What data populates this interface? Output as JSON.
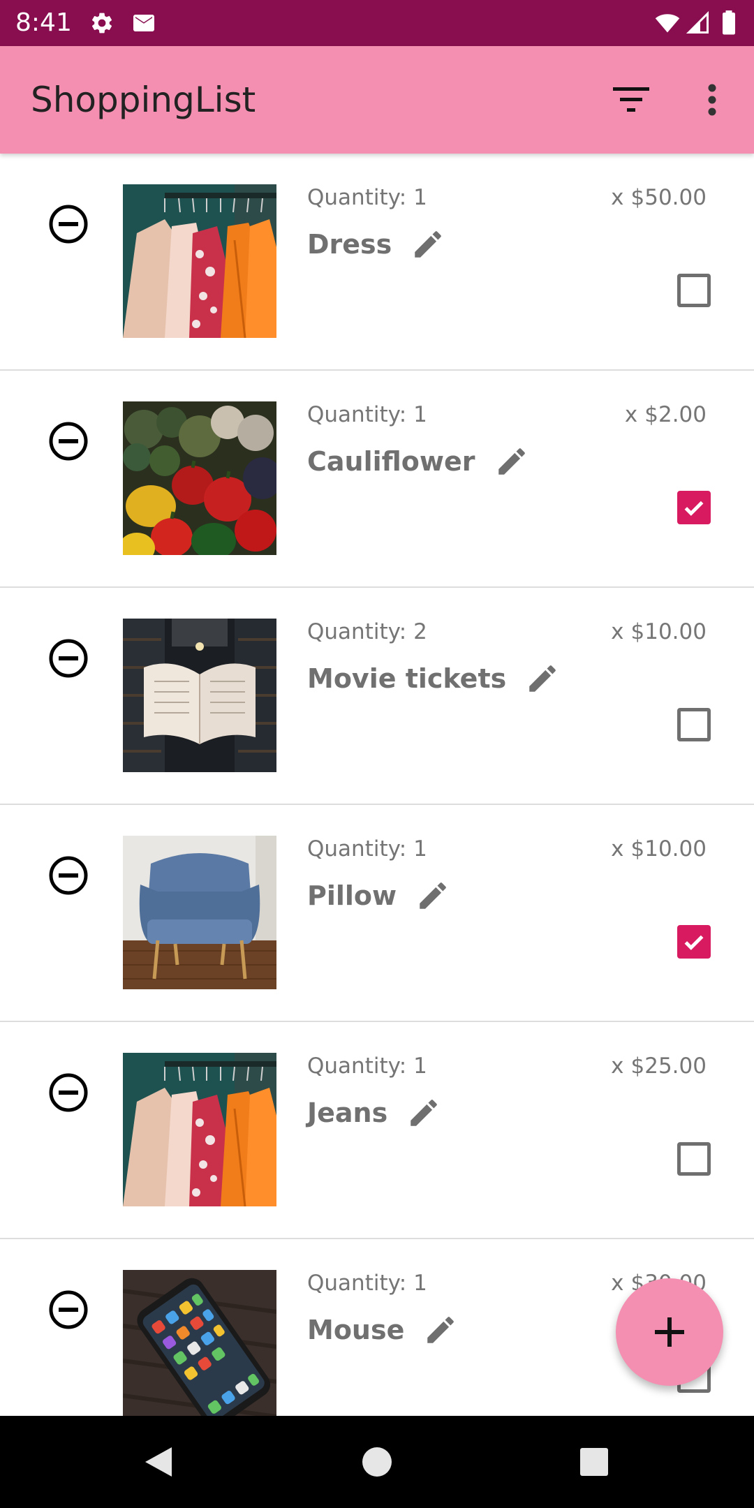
{
  "status_bar": {
    "time": "8:41",
    "icons": [
      "settings-icon",
      "mail-icon",
      "wifi-icon",
      "cell-signal-icon",
      "battery-icon"
    ],
    "background": "#880e4f"
  },
  "app_bar": {
    "title": "ShoppingList",
    "actions": [
      "filter-icon",
      "more-vert-icon"
    ],
    "background": "#f48fb1"
  },
  "items": [
    {
      "quantity_label": "Quantity:",
      "quantity": "1",
      "price_prefix": "x",
      "price": "$50.00",
      "name": "Dress",
      "checked": false,
      "image": "clothes-rack"
    },
    {
      "quantity_label": "Quantity:",
      "quantity": "1",
      "price_prefix": "x",
      "price": "$2.00",
      "name": "Cauliflower",
      "checked": true,
      "image": "vegetables"
    },
    {
      "quantity_label": "Quantity:",
      "quantity": "2",
      "price_prefix": "x",
      "price": "$10.00",
      "name": "Movie tickets",
      "checked": false,
      "image": "open-book"
    },
    {
      "quantity_label": "Quantity:",
      "quantity": "1",
      "price_prefix": "x",
      "price": "$10.00",
      "name": "Pillow",
      "checked": true,
      "image": "armchair"
    },
    {
      "quantity_label": "Quantity:",
      "quantity": "1",
      "price_prefix": "x",
      "price": "$25.00",
      "name": "Jeans",
      "checked": false,
      "image": "clothes-rack"
    },
    {
      "quantity_label": "Quantity:",
      "quantity": "1",
      "price_prefix": "x",
      "price": "$30.00",
      "name": "Mouse",
      "checked": false,
      "image": "smartphone"
    }
  ],
  "fab": {
    "icon": "add-icon"
  },
  "nav_bar": {
    "buttons": [
      "back-icon",
      "home-icon",
      "recents-icon"
    ]
  },
  "colors": {
    "accent": "#d81b60",
    "primary": "#f48fb1",
    "primary_dark": "#880e4f"
  }
}
